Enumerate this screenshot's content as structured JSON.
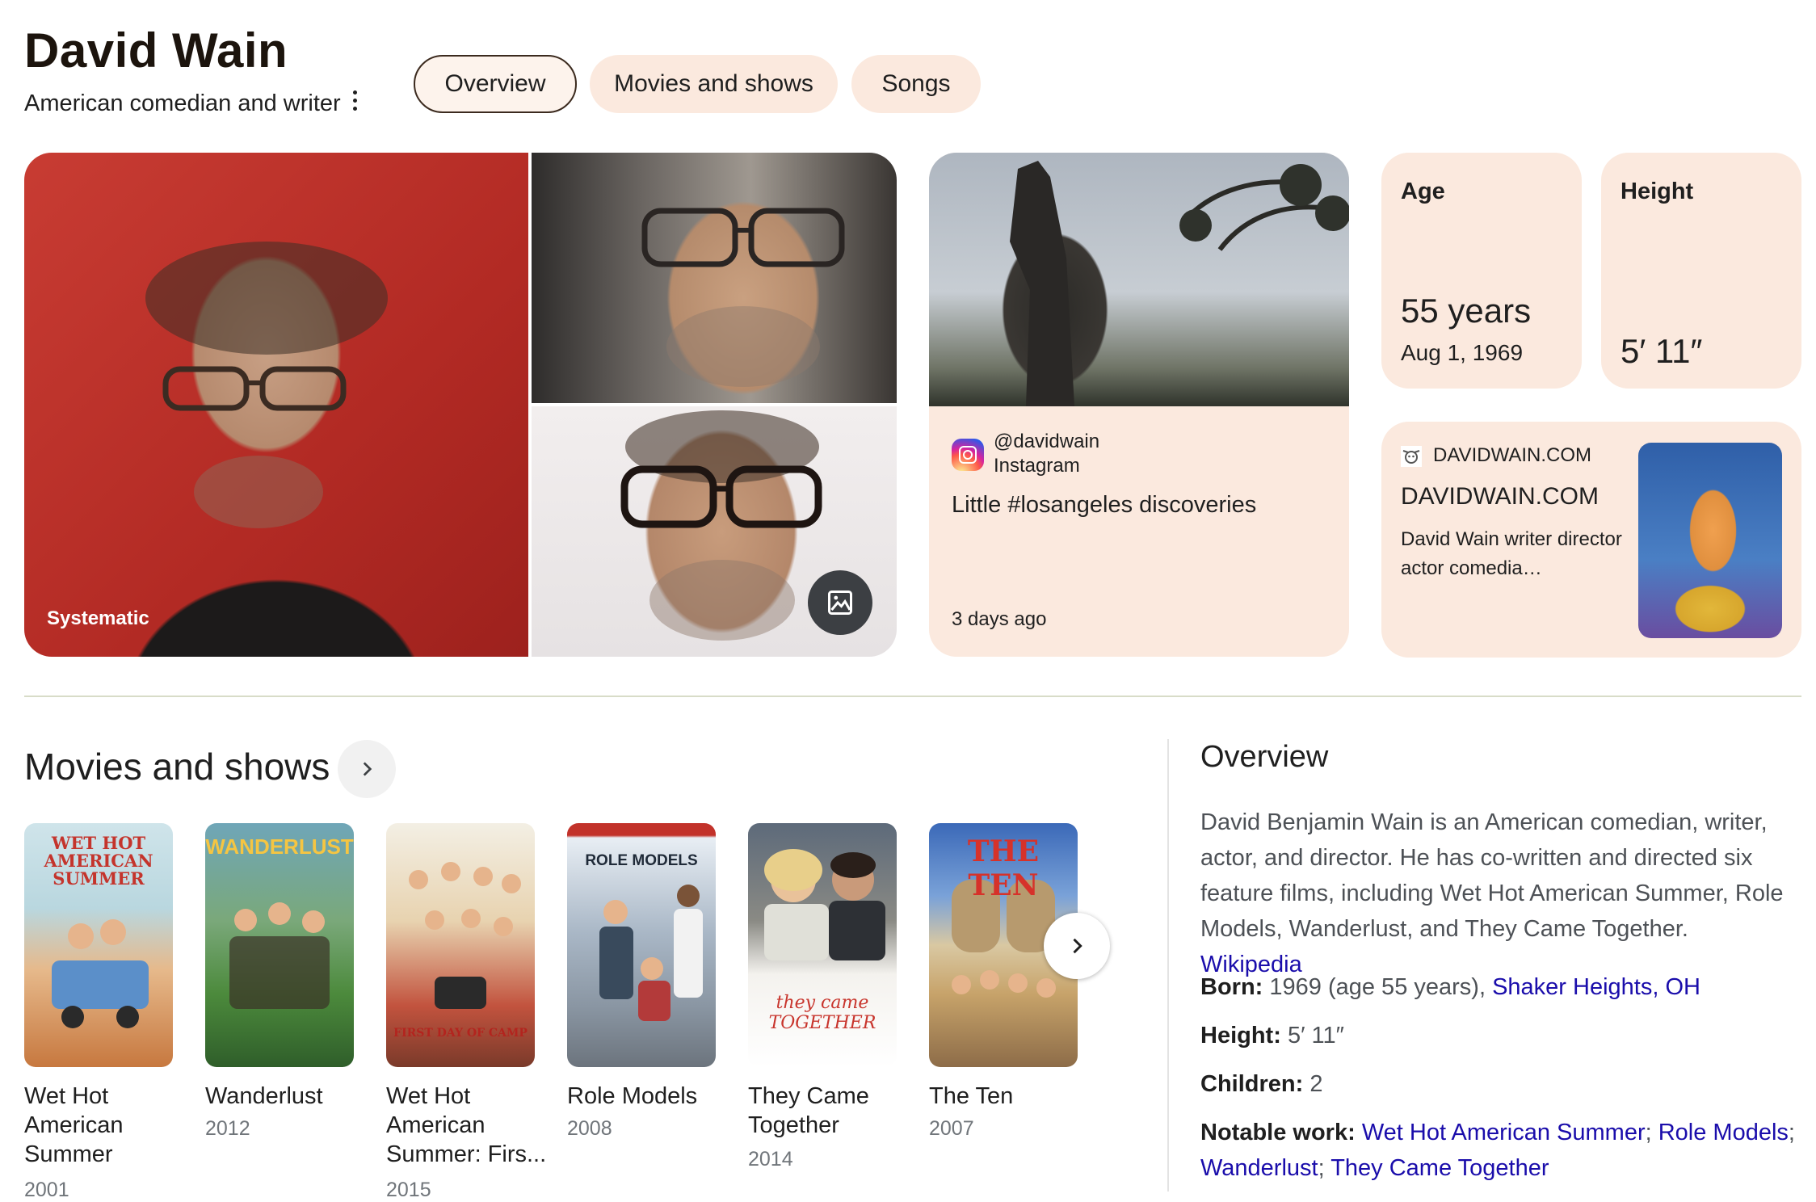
{
  "header": {
    "name": "David Wain",
    "subtitle": "American comedian and writer",
    "tabs": [
      {
        "label": "Overview",
        "active": true
      },
      {
        "label": "Movies and shows",
        "active": false
      },
      {
        "label": "Songs",
        "active": false
      }
    ]
  },
  "gallery": {
    "main_caption": "Systematic",
    "more_images_icon": "image-gallery-icon"
  },
  "instagram_card": {
    "handle": "@davidwain",
    "source": "Instagram",
    "post_text": "Little #losangeles discoveries",
    "time": "3 days ago"
  },
  "facts_cards": {
    "age": {
      "label": "Age",
      "value": "55 years",
      "sub": "Aug 1, 1969"
    },
    "height": {
      "label": "Height",
      "value": "5′ 11″"
    }
  },
  "website_card": {
    "source": "DAVIDWAIN.COM",
    "title": "DAVIDWAIN.COM",
    "description": "David Wain writer director actor comedia…"
  },
  "movies": {
    "heading": "Movies and shows",
    "items": [
      {
        "title": "Wet Hot American Summer",
        "year": "2001",
        "poster_text": "WET HOT AMERICAN SUMMER"
      },
      {
        "title": "Wanderlust",
        "year": "2012",
        "poster_text": "WANDERLUST"
      },
      {
        "title": "Wet Hot American Summer: Firs...",
        "year": "2015",
        "poster_text": "FIRST DAY OF CAMP"
      },
      {
        "title": "Role Models",
        "year": "2008",
        "poster_text": "ROLE MODELS"
      },
      {
        "title": "They Came Together",
        "year": "2014",
        "poster_text": "they came TOGETHER"
      },
      {
        "title": "The Ten",
        "year": "2007",
        "poster_text": "THE TEN"
      }
    ]
  },
  "overview": {
    "heading": "Overview",
    "description": "David Benjamin Wain is an American comedian, writer, actor, and director. He has co-written and directed six feature films, including Wet Hot American Summer, Role Models, Wanderlust, and They Came Together.",
    "source_link": "Wikipedia",
    "born_label": "Born:",
    "born_value": "1969 (age 55 years),",
    "born_place": "Shaker Heights, OH",
    "height_label": "Height:",
    "height_value": "5′ 11″",
    "children_label": "Children:",
    "children_value": "2",
    "notable_label": "Notable work:",
    "notable_works": [
      "Wet Hot American Summer",
      "Role Models",
      "Wanderlust",
      "They Came Together"
    ]
  },
  "colors": {
    "card_bg": "#fbe9de",
    "link": "#1a0dab",
    "chip_active_border": "#3b2a1e"
  }
}
